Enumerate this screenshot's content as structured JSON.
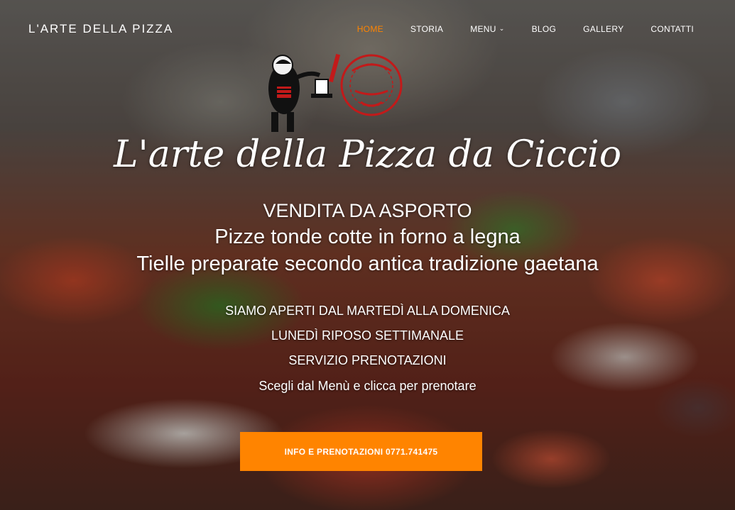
{
  "brand": {
    "name": "L'ARTE DELLA PIZZA"
  },
  "nav": {
    "items": [
      {
        "label": "HOME",
        "active": true
      },
      {
        "label": "STORIA"
      },
      {
        "label": "MENU",
        "has_dropdown": true
      },
      {
        "label": "BLOG"
      },
      {
        "label": "GALLERY"
      },
      {
        "label": "CONTATTI"
      }
    ],
    "active_color": "#ff8400"
  },
  "hero": {
    "title": "L'arte della Pizza da Ciccio",
    "line1": "VENDITA DA ASPORTO",
    "line2": "Pizze tonde cotte in forno a legna",
    "line3": "Tielle preparate secondo antica tradizione gaetana",
    "info": [
      "SIAMO APERTI DAL MARTEDÌ ALLA DOMENICA",
      "LUNEDÌ RIPOSO SETTIMANALE",
      "SERVIZIO PRENOTAZIONI",
      "Scegli dal Menù e clicca per prenotare"
    ],
    "cta_label": "INFO E PRENOTAZIONI 0771.741475",
    "cta_color": "#ff8400"
  },
  "logo": {
    "icon": "pizzeria-mascot-logo"
  }
}
